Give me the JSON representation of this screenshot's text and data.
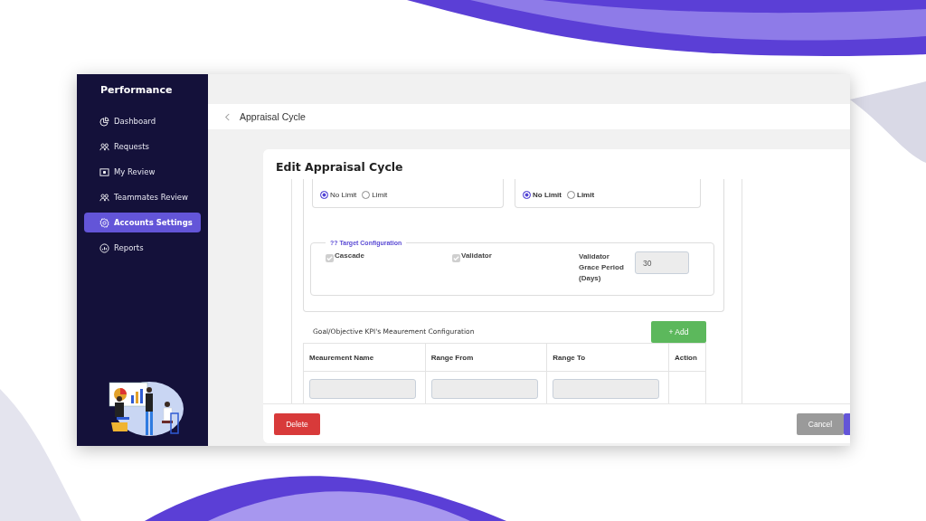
{
  "sidebar": {
    "brand": "Performance",
    "items": [
      {
        "label": "Dashboard",
        "kind": "pie",
        "selected": false
      },
      {
        "label": "Requests",
        "kind": "people",
        "selected": false
      },
      {
        "label": "My Review",
        "kind": "screen",
        "selected": false
      },
      {
        "label": "Teammates Review",
        "kind": "people",
        "selected": false
      },
      {
        "label": "Accounts Settings",
        "kind": "gear",
        "selected": true
      },
      {
        "label": "Reports",
        "kind": "report",
        "selected": false
      }
    ]
  },
  "header": {
    "title": "Appraisal Cycle"
  },
  "modal": {
    "title": "Edit Appraisal Cycle",
    "limit_groups": [
      {
        "options": [
          {
            "label": "No Limit",
            "selected": true
          },
          {
            "label": "Limit",
            "selected": false
          }
        ]
      },
      {
        "options": [
          {
            "label": "No Limit",
            "selected": true
          },
          {
            "label": "Limit",
            "selected": false
          }
        ]
      }
    ],
    "target_config": {
      "legend": "?? Target Configuration",
      "checkboxes": [
        {
          "label": "Cascade",
          "checked": true,
          "disabled": true
        },
        {
          "label": "Validator",
          "checked": true,
          "disabled": true
        }
      ],
      "grace_period": {
        "label": "Validator Grace Period (Days)",
        "value": "30"
      }
    },
    "measurement": {
      "title": "Goal/Objective KPI's Meaurement Configuration",
      "add_button": "+ Add",
      "columns": [
        "Meaurement Name",
        "Range From",
        "Range To",
        "Action"
      ]
    },
    "footer": {
      "delete": "Delete",
      "cancel": "Cancel"
    }
  }
}
